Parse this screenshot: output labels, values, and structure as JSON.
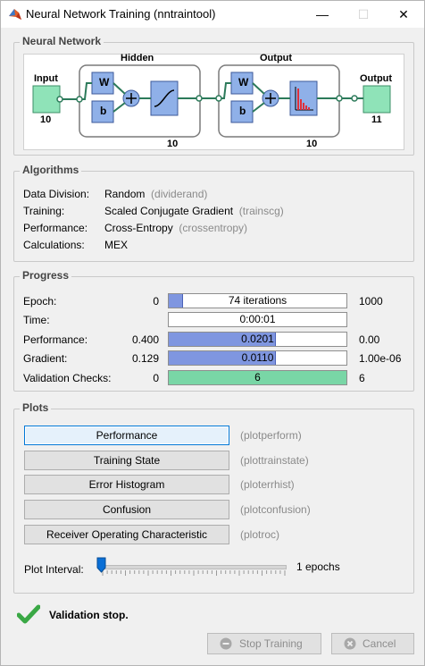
{
  "window": {
    "title": "Neural Network Training (nntraintool)",
    "minimize": "—",
    "maximize": "☐",
    "close": "✕"
  },
  "neural_network": {
    "title": "Neural Network",
    "input_label": "Input",
    "input_size": "10",
    "hidden_label": "Hidden",
    "hidden_size": "10",
    "output_layer_label": "Output",
    "output_layer_size": "10",
    "output_label": "Output",
    "output_size": "11",
    "w": "W",
    "b": "b"
  },
  "algorithms": {
    "title": "Algorithms",
    "rows": [
      {
        "key": "Data Division:",
        "value": "Random",
        "func": "(dividerand)"
      },
      {
        "key": "Training:",
        "value": "Scaled Conjugate Gradient",
        "func": "(trainscg)"
      },
      {
        "key": "Performance:",
        "value": "Cross-Entropy",
        "func": "(crossentropy)"
      },
      {
        "key": "Calculations:",
        "value": "MEX",
        "func": ""
      }
    ]
  },
  "progress": {
    "title": "Progress",
    "rows": [
      {
        "label": "Epoch:",
        "start": "0",
        "text": "74 iterations",
        "end": "1000",
        "fill": 0.074
      },
      {
        "label": "Time:",
        "start": "",
        "text": "0:00:01",
        "end": "",
        "fill": 0
      },
      {
        "label": "Performance:",
        "start": "0.400",
        "text": "0.0201",
        "end": "0.00",
        "fill": 0.6
      },
      {
        "label": "Gradient:",
        "start": "0.129",
        "text": "0.0110",
        "end": "1.00e-06",
        "fill": 0.6
      },
      {
        "label": "Validation Checks:",
        "start": "0",
        "text": "6",
        "end": "6",
        "fill": 1.0
      }
    ]
  },
  "plots": {
    "title": "Plots",
    "buttons": [
      {
        "label": "Performance",
        "func": "(plotperform)"
      },
      {
        "label": "Training State",
        "func": "(plottrainstate)"
      },
      {
        "label": "Error Histogram",
        "func": "(ploterrhist)"
      },
      {
        "label": "Confusion",
        "func": "(plotconfusion)"
      },
      {
        "label": "Receiver Operating Characteristic",
        "func": "(plotroc)"
      }
    ],
    "interval_label": "Plot Interval:",
    "interval_value": "1 epochs",
    "interval_fraction": 0.0
  },
  "status": {
    "text": "Validation stop."
  },
  "actions": {
    "stop_training": "Stop Training",
    "cancel": "Cancel"
  },
  "colors": {
    "accent_blue": "#7f96e0",
    "accent_green": "#79d6a6",
    "nn_block": "#8fb0e8",
    "nn_io": "#8fe3b8"
  }
}
